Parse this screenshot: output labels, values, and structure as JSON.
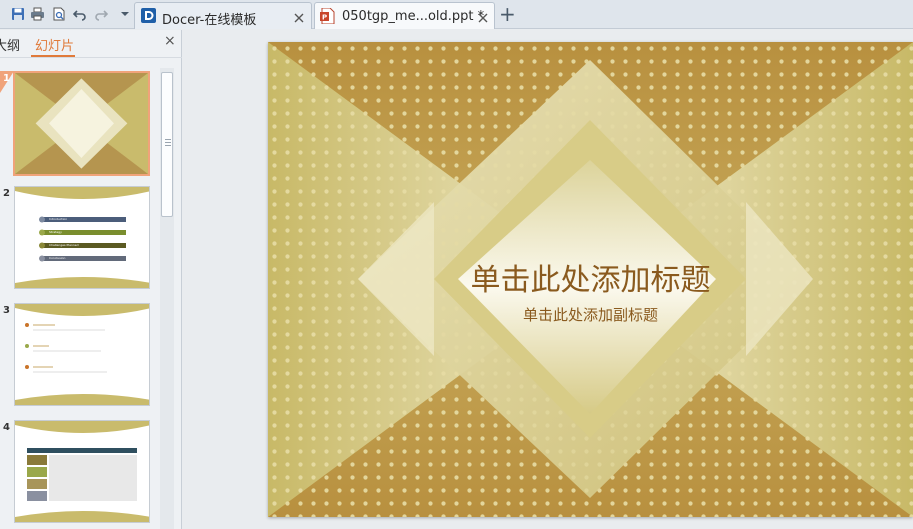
{
  "toolbar": {
    "save_icon": "save-icon",
    "print_icon": "print-icon",
    "print_preview_icon": "print-preview-icon",
    "undo_icon": "undo-icon",
    "redo_icon": "redo-icon",
    "more_icon": "chevron-down-icon"
  },
  "tabs": [
    {
      "title": "Docer-在线模板",
      "icon": "docer-icon",
      "active": false
    },
    {
      "title": "050tgp_me...old.ppt *",
      "icon": "ppt-file-icon",
      "active": true
    }
  ],
  "new_tab_label": "+",
  "panel": {
    "outline_tab": "大纲",
    "slides_tab": "幻灯片",
    "close": "×"
  },
  "thumbnails": [
    {
      "number": "1",
      "selected": true
    },
    {
      "number": "2",
      "selected": false,
      "items": [
        "Introduction",
        "Strategy",
        "Challenges Planned",
        "Conclusion"
      ]
    },
    {
      "number": "3",
      "selected": false
    },
    {
      "number": "4",
      "selected": false
    }
  ],
  "slide": {
    "title": "单击此处添加标题",
    "subtitle": "单击此处添加副标题",
    "colors": {
      "base": "#c9bb6c",
      "dark": "#b08c48",
      "light": "#f5f2dc",
      "title": "#8a5a1e"
    }
  }
}
